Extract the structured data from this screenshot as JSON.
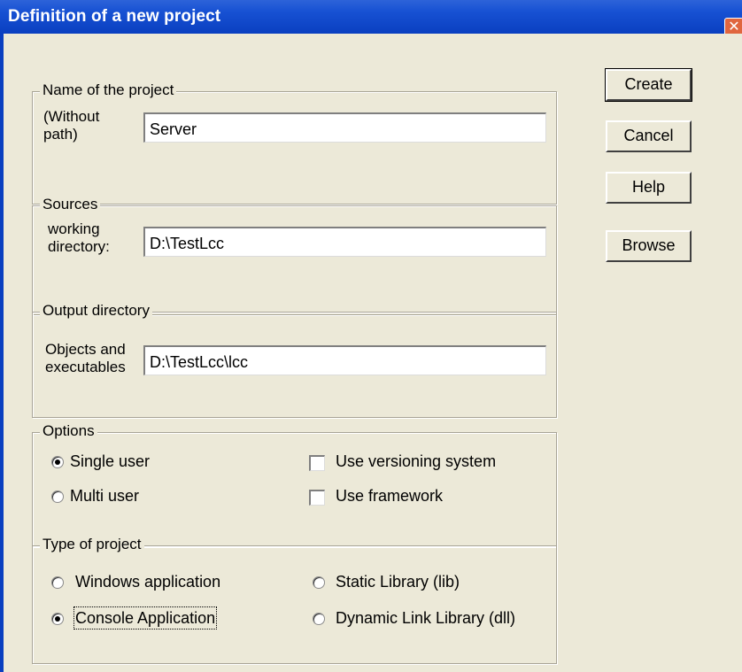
{
  "window": {
    "title": "Definition of a new project"
  },
  "project_name": {
    "group_label": "Name of the project",
    "field_label": "(Without\npath)",
    "value": "Server"
  },
  "sources": {
    "group_label": "Sources",
    "field_label": "working\ndirectory:",
    "value": "D:\\TestLcc"
  },
  "output": {
    "group_label": "Output directory",
    "field_label": "Objects and\nexecutables",
    "value": "D:\\TestLcc\\lcc"
  },
  "options": {
    "group_label": "Options",
    "single_user": {
      "label": "Single user",
      "selected": true
    },
    "multi_user": {
      "label": "Multi user",
      "selected": false
    },
    "use_versioning": {
      "label": "Use versioning system",
      "checked": false
    },
    "use_framework": {
      "label": "Use framework",
      "checked": false
    }
  },
  "project_type": {
    "group_label": "Type of project",
    "windows_app": {
      "label": "Windows application",
      "selected": false
    },
    "console_app": {
      "label": "Console Application",
      "selected": true
    },
    "static_lib": {
      "label": "Static Library (lib)",
      "selected": false
    },
    "dynamic_lib": {
      "label": "Dynamic Link Library (dll)",
      "selected": false
    }
  },
  "buttons": {
    "create": "Create",
    "cancel": "Cancel",
    "help": "Help",
    "browse": "Browse"
  },
  "colors": {
    "titlebar": "#0a3fc0",
    "dialog_bg": "#ece9d8",
    "close_button": "#e0663e"
  }
}
